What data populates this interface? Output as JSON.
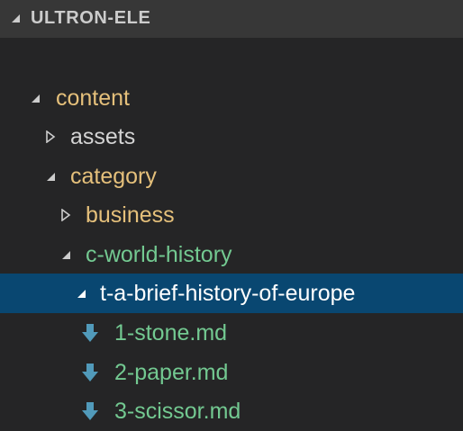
{
  "explorer": {
    "section_title": "ULTRON-ELE"
  },
  "tree": {
    "items": [
      {
        "label": "content",
        "state": "expanded",
        "kind": "folder"
      },
      {
        "label": "assets",
        "state": "collapsed",
        "kind": "folder"
      },
      {
        "label": "category",
        "state": "expanded",
        "kind": "folder"
      },
      {
        "label": "business",
        "state": "collapsed",
        "kind": "folder"
      },
      {
        "label": "c-world-history",
        "state": "expanded",
        "kind": "folder"
      },
      {
        "label": "t-a-brief-history-of-europe",
        "state": "expanded",
        "kind": "folder",
        "selected": true
      },
      {
        "label": "1-stone.md",
        "kind": "file",
        "icon": "markdown-down-arrow-icon"
      },
      {
        "label": "2-paper.md",
        "kind": "file",
        "icon": "markdown-down-arrow-icon"
      },
      {
        "label": "3-scissor.md",
        "kind": "file",
        "icon": "markdown-down-arrow-icon"
      }
    ]
  },
  "colors": {
    "background": "#252526",
    "header_background": "#373737",
    "selection": "#094771",
    "folder_text": "#e5c07b",
    "file_text": "#73c991",
    "file_icon": "#519aba"
  }
}
